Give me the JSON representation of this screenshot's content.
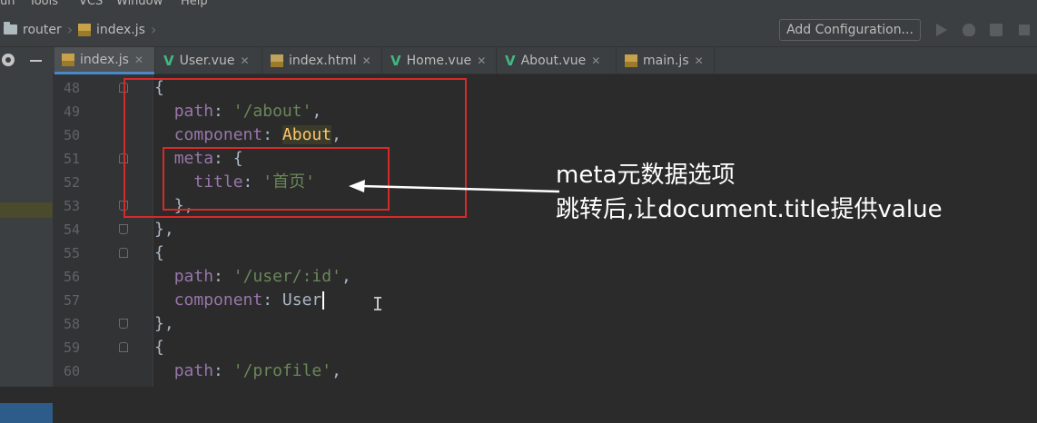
{
  "menu": [
    "un",
    "Tools",
    "VCS",
    "Window",
    "Help"
  ],
  "breadcrumb": [
    "router",
    "index.js"
  ],
  "toolbar": {
    "add_configuration": "Add Configuration..."
  },
  "tabs": [
    {
      "label": "index.js",
      "type": "js",
      "active": true
    },
    {
      "label": "User.vue",
      "type": "vue"
    },
    {
      "label": "index.html",
      "type": "html"
    },
    {
      "label": "Home.vue",
      "type": "vue"
    },
    {
      "label": "About.vue",
      "type": "vue"
    },
    {
      "label": "main.js",
      "type": "js"
    }
  ],
  "code": {
    "line_numbers": [
      "48",
      "49",
      "50",
      "51",
      "52",
      "53",
      "54",
      "55",
      "56",
      "57",
      "58",
      "59",
      "60"
    ],
    "l48": "{",
    "l49_key": "path",
    "l49_val": "'/about'",
    "l50_key": "component",
    "l50_val": "About",
    "l51_key": "meta",
    "l51_rest": ": {",
    "l52_key": "title",
    "l52_val": "'首页'",
    "l53": "},",
    "l54": "},",
    "l55": "{",
    "l56_key": "path",
    "l56_val": "'/user/:id'",
    "l57_key": "component",
    "l57_val": "User",
    "l58": "},",
    "l59": "{",
    "l60_key": "path",
    "l60_val": "'/profile'"
  },
  "annotation": {
    "line1": "meta元数据选项",
    "line2": "跳转后,让document.title提供value"
  },
  "colors": {
    "background": "#2b2b2b",
    "keyword": "#9876aa",
    "string": "#6a8759",
    "highlight_box": "#d62a2a",
    "vue": "#41b883"
  }
}
